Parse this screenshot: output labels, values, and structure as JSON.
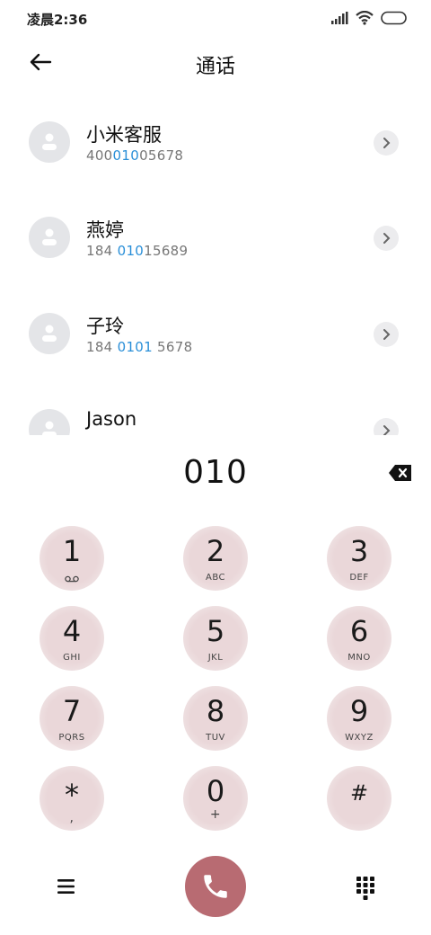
{
  "status_bar": {
    "time": "凌晨2:36"
  },
  "header": {
    "title": "通话"
  },
  "contacts": [
    {
      "name": "小米客服",
      "number_parts": [
        "400",
        "010",
        "05678"
      ]
    },
    {
      "name": "燕婷",
      "number_parts": [
        "184 ",
        "010",
        "15689"
      ]
    },
    {
      "name": "子玲",
      "number_parts": [
        "184 ",
        "0101",
        " 5678"
      ]
    },
    {
      "name": "Jason",
      "number_parts": [
        "",
        "",
        ""
      ]
    }
  ],
  "dialer": {
    "input": "010",
    "keys": [
      {
        "digit": "1",
        "letters": ""
      },
      {
        "digit": "2",
        "letters": "ABC"
      },
      {
        "digit": "3",
        "letters": "DEF"
      },
      {
        "digit": "4",
        "letters": "GHI"
      },
      {
        "digit": "5",
        "letters": "JKL"
      },
      {
        "digit": "6",
        "letters": "MNO"
      },
      {
        "digit": "7",
        "letters": "PQRS"
      },
      {
        "digit": "8",
        "letters": "TUV"
      },
      {
        "digit": "9",
        "letters": "WXYZ"
      },
      {
        "digit": "*",
        "letters": ","
      },
      {
        "digit": "0",
        "letters": "+"
      },
      {
        "digit": "#",
        "letters": ""
      }
    ]
  },
  "colors": {
    "highlight": "#2a8fd8",
    "call_button": "#b86b72",
    "key_bg": "#ead7d9"
  },
  "icons": {
    "status": [
      "signal-icon",
      "wifi-icon",
      "battery-icon"
    ],
    "back": "arrow-left-icon",
    "detail": "chevron-right-icon",
    "backspace": "backspace-icon",
    "voicemail": "voicemail-icon",
    "menu": "menu-icon",
    "call": "phone-icon",
    "keypad_toggle": "dialpad-icon"
  }
}
